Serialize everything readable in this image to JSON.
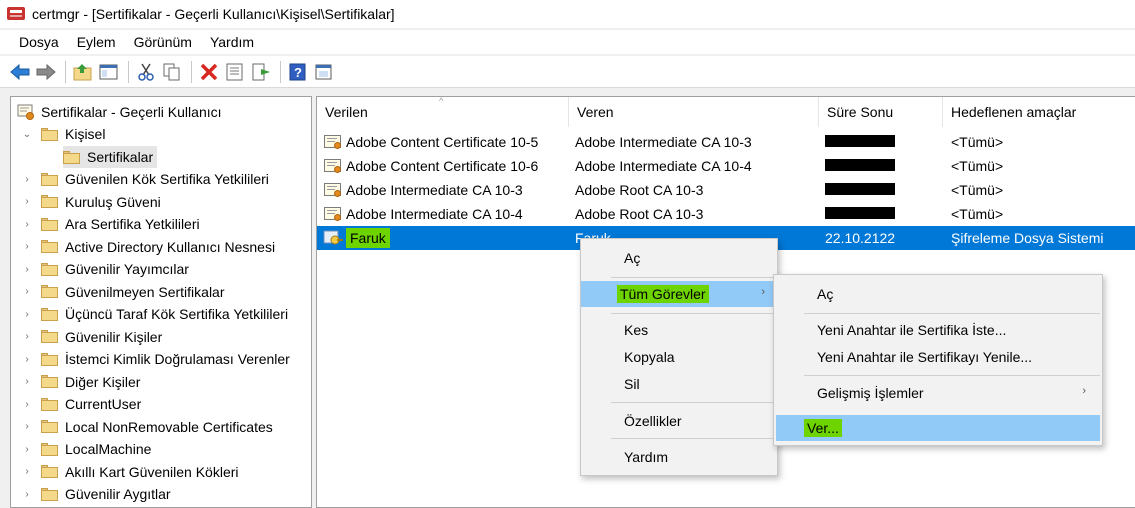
{
  "window": {
    "title": "certmgr - [Sertifikalar - Geçerli Kullanıcı\\Kişisel\\Sertifikalar]"
  },
  "menu": [
    "Dosya",
    "Eylem",
    "Görünüm",
    "Yardım"
  ],
  "toolbar": [
    "back-arrow-icon",
    "forward-arrow-icon",
    "up-folder-icon",
    "show-hide-tree-icon",
    "cut-icon",
    "copy-icon",
    "delete-icon",
    "properties-icon",
    "export-icon",
    "help-icon",
    "view-icon"
  ],
  "tree": {
    "root": "Sertifikalar - Geçerli Kullanıcı",
    "personal": "Kişisel",
    "certificates": "Sertifikalar",
    "items": [
      "Güvenilen Kök Sertifika Yetkilileri",
      "Kuruluş Güveni",
      "Ara Sertifika Yetkilileri",
      "Active Directory Kullanıcı Nesnesi",
      "Güvenilir Yayımcılar",
      "Güvenilmeyen Sertifikalar",
      "Üçüncü Taraf Kök Sertifika Yetkilileri",
      "Güvenilir Kişiler",
      "İstemci Kimlik Doğrulaması Verenler",
      "Diğer Kişiler",
      "CurrentUser",
      "Local NonRemovable Certificates",
      "LocalMachine",
      "Akıllı Kart Güvenilen Kökleri",
      "Güvenilir Aygıtlar"
    ]
  },
  "list": {
    "columns": [
      "Verilen",
      "Veren",
      "Süre Sonu",
      "Hedeflenen amaçlar"
    ],
    "rows": [
      {
        "issued_to": "Adobe Content Certificate 10-5",
        "issued_by": "Adobe Intermediate CA 10-3",
        "expires": "",
        "purposes": "<Tümü>"
      },
      {
        "issued_to": "Adobe Content Certificate 10-6",
        "issued_by": "Adobe Intermediate CA 10-4",
        "expires": "",
        "purposes": "<Tümü>"
      },
      {
        "issued_to": "Adobe Intermediate CA 10-3",
        "issued_by": "Adobe Root CA 10-3",
        "expires": "",
        "purposes": "<Tümü>"
      },
      {
        "issued_to": "Adobe Intermediate CA 10-4",
        "issued_by": "Adobe Root CA 10-3",
        "expires": "",
        "purposes": "<Tümü>"
      },
      {
        "issued_to": "Faruk",
        "issued_by": "Faruk",
        "expires": "22.10.2122",
        "purposes": "Şifreleme Dosya Sistemi"
      }
    ]
  },
  "context_menu": [
    "Aç",
    "Tüm Görevler",
    "Kes",
    "Kopyala",
    "Sil",
    "Özellikler",
    "Yardım"
  ],
  "submenu": [
    "Aç",
    "Yeni Anahtar ile Sertifika İste...",
    "Yeni Anahtar ile Sertifikayı Yenile...",
    "Gelişmiş İşlemler",
    "Ver..."
  ],
  "colors": {
    "selection": "#0078d7",
    "highlight": "#6dd400",
    "menu_hover": "#91c9f7"
  }
}
